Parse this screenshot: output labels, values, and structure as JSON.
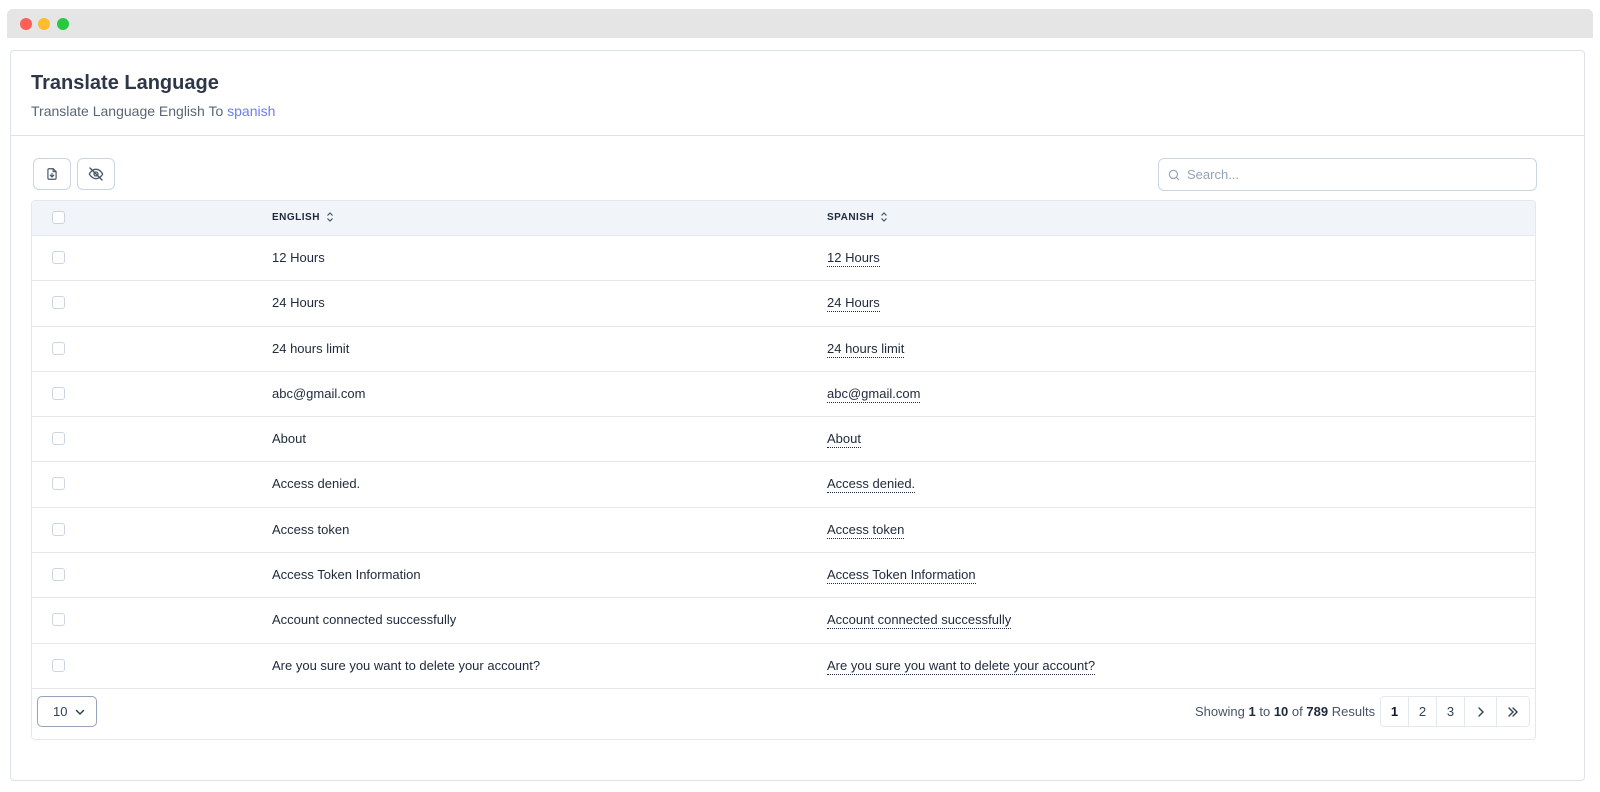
{
  "header": {
    "title": "Translate Language",
    "subtitle_prefix": "Translate Language English To",
    "subtitle_lang": "spanish"
  },
  "toolbar": {
    "export_icon": "file-export-icon",
    "hide_icon": "eye-off-icon",
    "search_placeholder": "Search..."
  },
  "table": {
    "columns": [
      "ENGLISH",
      "SPANISH"
    ],
    "rows": [
      {
        "english": "12 Hours",
        "spanish": "12 Hours"
      },
      {
        "english": "24 Hours",
        "spanish": "24 Hours"
      },
      {
        "english": "24 hours limit",
        "spanish": "24 hours limit"
      },
      {
        "english": "abc@gmail.com",
        "spanish": "abc@gmail.com"
      },
      {
        "english": "About",
        "spanish": "About"
      },
      {
        "english": "Access denied.",
        "spanish": "Access denied."
      },
      {
        "english": "Access token",
        "spanish": "Access token"
      },
      {
        "english": "Access Token Information",
        "spanish": "Access Token Information"
      },
      {
        "english": "Account connected successfully",
        "spanish": "Account connected successfully"
      },
      {
        "english": "Are you sure you want to delete your account?",
        "spanish": "Are you sure you want to delete your account?"
      }
    ]
  },
  "footer": {
    "per_page": "10",
    "showing_label": "Showing",
    "from": "1",
    "to_label": "to",
    "to": "10",
    "of_label": "of",
    "total": "789",
    "results_label": "Results",
    "pages": [
      "1",
      "2",
      "3"
    ],
    "active_page": "1"
  },
  "colors": {
    "accent_link": "#6b7cf6",
    "header_bg": "#f1f5f9",
    "border": "#dbe2ea"
  }
}
